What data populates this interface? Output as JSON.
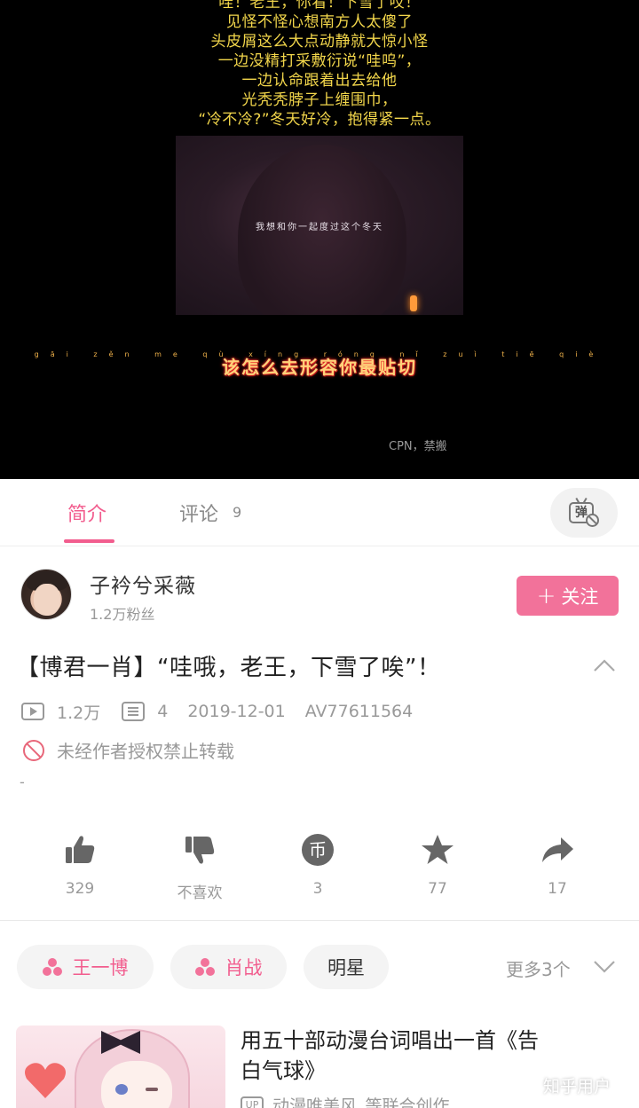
{
  "player": {
    "lyrics": [
      "哇！老王，你看！下雪了哎！",
      "见怪不怪心想南方人太傻了",
      "头皮屑这么大点动静就大惊小怪",
      "一边没精打采敷衍说“哇呜”，",
      "一边认命跟着出去给他",
      "光秃秃脖子上缠围巾，",
      "“冷不冷?”冬天好冷，抱得紧一点。"
    ],
    "inset_caption": "我想和你一起度过这个冬天",
    "pinyin": "gāi zěn me qù xíng róng nǐ zuì tiē qiè",
    "karaoke": "该怎么去形容你最贴切",
    "credit": "CPN，禁搬"
  },
  "tabs": {
    "intro": "简介",
    "comments": "评论",
    "comments_count": "9",
    "danmaku_glyph": "弹",
    "danmaku_icon": "danmaku-off-icon"
  },
  "uploader": {
    "name": "子衿兮采薇",
    "fans": "1.2万粉丝",
    "follow_plus": "+",
    "follow_label": "关注"
  },
  "video": {
    "title": "【博君一肖】“哇哦，老王，下雪了唉”！",
    "views": "1.2万",
    "danmaku_count": "4",
    "date": "2019-12-01",
    "av": "AV77611564",
    "no_repost": "未经作者授权禁止转载",
    "description": "-"
  },
  "actions": {
    "like": "329",
    "dislike": "不喜欢",
    "coin": "3",
    "favorite": "77",
    "share": "17"
  },
  "tags": {
    "items": [
      "王一博",
      "肖战",
      "明星"
    ],
    "more": "更多3个"
  },
  "recommended": {
    "title": "用五十部动漫台词唱出一首《告白气球》",
    "up_badge": "UP",
    "meta": "动漫唯美风_等联合创作"
  },
  "watermark": "知乎用户",
  "colors": {
    "accent": "#f25d8e",
    "follow_button": "#f2729a",
    "lyrics": "#f2d64b"
  }
}
